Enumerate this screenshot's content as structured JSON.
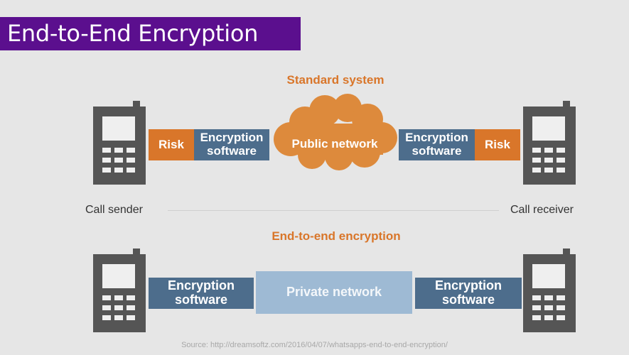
{
  "slide": {
    "title": "End-to-End Encryption",
    "source": "Source: http://dreamsoftz.com/2016/04/07/whatsapps-end-to-end-encryption/"
  },
  "standard": {
    "heading": "Standard system",
    "risk_left": "Risk",
    "enc_left": "Encryption software",
    "network": "Public network",
    "enc_right": "Encryption software",
    "risk_right": "Risk"
  },
  "labels": {
    "sender": "Call sender",
    "receiver": "Call receiver"
  },
  "e2e": {
    "heading": "End-to-end encryption",
    "enc_left": "Encryption software",
    "network": "Private network",
    "enc_right": "Encryption software"
  },
  "colors": {
    "title_bg": "#5b0f8e",
    "orange": "#d9762a",
    "blue": "#4d6d8c",
    "light_blue": "#9ebad4",
    "phone": "#555555"
  },
  "icons": [
    "phone-icon",
    "cloud-icon"
  ]
}
